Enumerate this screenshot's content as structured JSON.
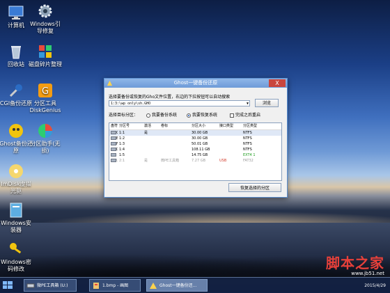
{
  "desktop_icons": [
    {
      "label": "计算机"
    },
    {
      "label": "Windows引\n导修复"
    },
    {
      "label": "回收站"
    },
    {
      "label": "磁盘碎片整理"
    },
    {
      "label": "CGI备份还原"
    },
    {
      "label": "分区工具\nDiskGenius"
    },
    {
      "label": "Ghost备份还\n原"
    },
    {
      "label": "分区助手(无\n损)"
    },
    {
      "label": "ImDisk虚拟\n光驱"
    },
    {
      "label": "Windows安\n装器"
    },
    {
      "label": "Windows密\n码修改"
    }
  ],
  "dialog": {
    "title": "Ghost一键备份还原",
    "close_label": "X",
    "prompt": "选择要备份或恢复的Gho文件位置，右边的下拉按钮可以自动搜索",
    "path_value": "1:3:\\wp only\\sh.GHO",
    "browse_label": "浏览",
    "target_label": "选择目标分区：",
    "radio_backup": "我要备份系统",
    "radio_restore": "我要恢复系统",
    "check_restart": "完成之后重启",
    "columns": [
      "盘符",
      "分区号",
      "激活",
      "卷标",
      "分区大小",
      "接口类型",
      "分区类型"
    ],
    "rows": [
      {
        "drive": "C:",
        "num": "1:1",
        "active": "是",
        "label": "",
        "size": "30.00 GB",
        "iface": "",
        "type": "NTFS"
      },
      {
        "drive": "E:",
        "num": "1:2",
        "active": "",
        "label": "",
        "size": "30.00 GB",
        "iface": "",
        "type": "NTFS"
      },
      {
        "drive": "F:",
        "num": "1:3",
        "active": "",
        "label": "",
        "size": "50.01 GB",
        "iface": "",
        "type": "NTFS"
      },
      {
        "drive": "D:",
        "num": "1:4",
        "active": "",
        "label": "",
        "size": "108.11 GB",
        "iface": "",
        "type": "NTFS"
      },
      {
        "drive": "",
        "num": "1:5",
        "active": "",
        "label": "",
        "size": "14.75 GB",
        "iface": "",
        "type": "EXT4 1"
      },
      {
        "drive": "U:",
        "num": "2:1",
        "active": "是",
        "label": "微PE工具箱",
        "size": "7.27 GB",
        "iface": "USB",
        "type": "FAT32"
      }
    ],
    "restore_button": "恢复选择的分区"
  },
  "taskbar": {
    "tasks": [
      {
        "label": "微PE工具箱 (U:)"
      },
      {
        "label": "1.bmp - 画图"
      },
      {
        "label": "Ghost一键备份还..."
      }
    ],
    "date": "2015/4/29"
  },
  "watermark": {
    "text": "脚本之家",
    "url": "www.jb51.net"
  },
  "colors": {
    "title_bar": "#7aa6e0",
    "close_button": "#c9463d",
    "taskbar": "#142346"
  }
}
